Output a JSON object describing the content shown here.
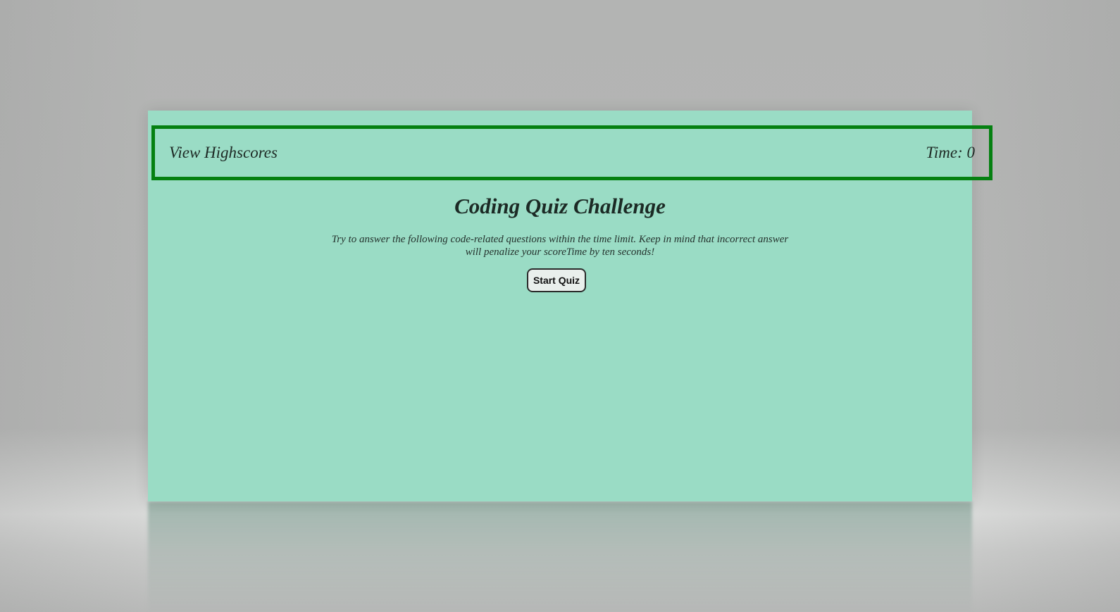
{
  "header": {
    "highscores_label": "View Highscores",
    "timer_label": "Time: 0"
  },
  "main": {
    "title": "Coding Quiz Challenge",
    "description": "Try to answer the following code-related questions within the time limit. Keep in mind that incorrect answer will penalize your scoreTime by ten seconds!",
    "start_button_label": "Start Quiz"
  },
  "colors": {
    "page_background": "#9adcc5",
    "header_border": "#058011",
    "backdrop": "#b5b6b5"
  }
}
